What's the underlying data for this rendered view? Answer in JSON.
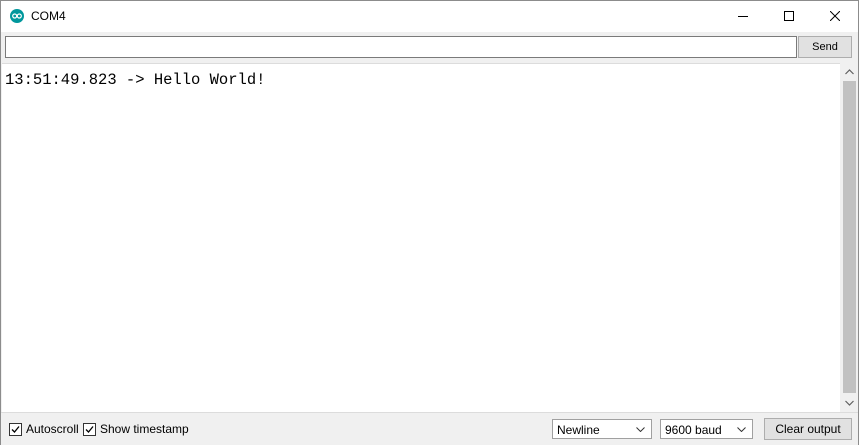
{
  "window": {
    "title": "COM4",
    "app_icon": "arduino-icon",
    "controls": [
      "minimize-icon",
      "maximize-icon",
      "close-icon"
    ]
  },
  "send_bar": {
    "input_value": "",
    "send_label": "Send"
  },
  "output": {
    "lines": [
      "13:51:49.823 -> Hello World!"
    ]
  },
  "footer": {
    "autoscroll_label": "Autoscroll",
    "autoscroll_checked": true,
    "timestamp_label": "Show timestamp",
    "timestamp_checked": true,
    "line_ending_value": "Newline",
    "baud_value": "9600 baud",
    "clear_label": "Clear output"
  },
  "colors": {
    "accent": "#00979c"
  }
}
